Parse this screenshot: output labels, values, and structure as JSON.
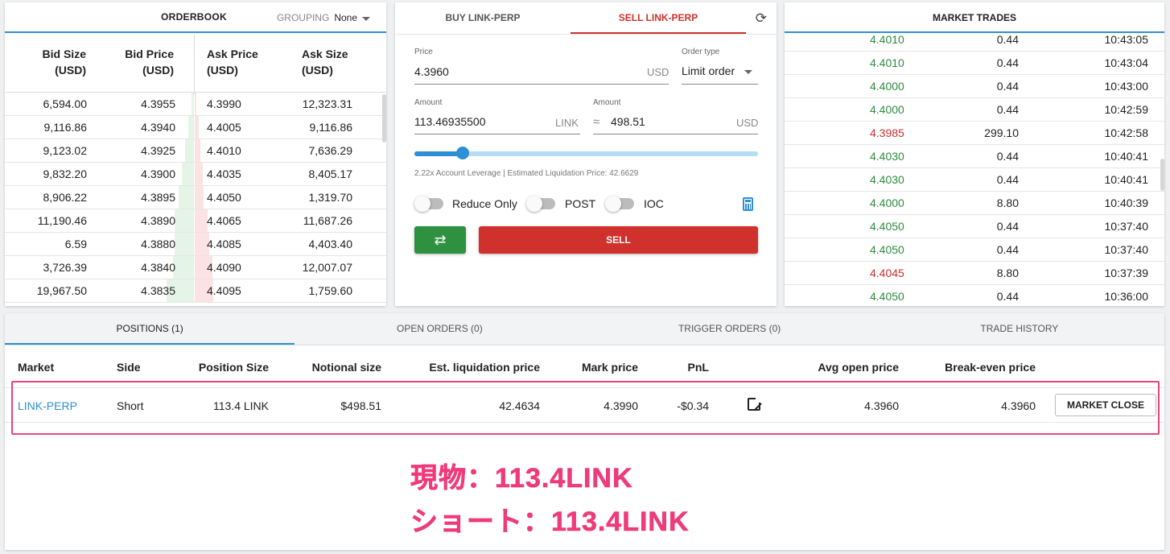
{
  "orderbook": {
    "title": "ORDERBOOK",
    "grouping_label": "GROUPING",
    "grouping_value": "None",
    "columns": [
      "Bid Size",
      "(USD)",
      "Bid Price",
      "(USD)",
      "Ask Price",
      "(USD)",
      "Ask Size",
      "(USD)"
    ],
    "rows": [
      {
        "bid_size": "6,594.00",
        "bid_price": "4.3955",
        "ask_price": "4.3990",
        "ask_size": "12,323.31",
        "bid_depth": 0.04,
        "ask_depth": 0.03
      },
      {
        "bid_size": "9,116.86",
        "bid_price": "4.3940",
        "ask_price": "4.4005",
        "ask_size": "9,116.86",
        "bid_depth": 0.09,
        "ask_depth": 0.06
      },
      {
        "bid_size": "9,123.02",
        "bid_price": "4.3925",
        "ask_price": "4.4010",
        "ask_size": "7,636.29",
        "bid_depth": 0.14,
        "ask_depth": 0.09
      },
      {
        "bid_size": "9,832.20",
        "bid_price": "4.3900",
        "ask_price": "4.4035",
        "ask_size": "8,405.17",
        "bid_depth": 0.19,
        "ask_depth": 0.13
      },
      {
        "bid_size": "8,906.22",
        "bid_price": "4.3895",
        "ask_price": "4.4050",
        "ask_size": "1,319.70",
        "bid_depth": 0.24,
        "ask_depth": 0.14
      },
      {
        "bid_size": "11,190.46",
        "bid_price": "4.3890",
        "ask_price": "4.4065",
        "ask_size": "11,687.26",
        "bid_depth": 0.3,
        "ask_depth": 0.2
      },
      {
        "bid_size": "6.59",
        "bid_price": "4.3880",
        "ask_price": "4.4085",
        "ask_size": "4,403.40",
        "bid_depth": 0.3,
        "ask_depth": 0.22
      },
      {
        "bid_size": "3,726.39",
        "bid_price": "4.3840",
        "ask_price": "4.4090",
        "ask_size": "12,007.07",
        "bid_depth": 0.32,
        "ask_depth": 0.28
      },
      {
        "bid_size": "19,967.50",
        "bid_price": "4.3835",
        "ask_price": "4.4095",
        "ask_size": "1,759.60",
        "bid_depth": 0.42,
        "ask_depth": 0.29
      }
    ]
  },
  "trade_form": {
    "tabs": [
      "BUY LINK-PERP",
      "SELL LINK-PERP"
    ],
    "active_tab": 1,
    "price_label": "Price",
    "price_value": "4.3960",
    "price_unit": "USD",
    "order_type_label": "Order type",
    "order_type_value": "Limit order",
    "amount_label": "Amount",
    "amount_value": "113.46935500",
    "amount_unit": "LINK",
    "amount_usd_label": "Amount",
    "approx_symbol": "≈",
    "amount_usd_value": "498.51",
    "amount_usd_unit": "USD",
    "slider_fraction": 0.14,
    "leverage_text": "2.22x Account Leverage | Estimated Liquidation Price: 42.6629",
    "toggles": [
      {
        "label": "Reduce Only",
        "on": false
      },
      {
        "label": "POST",
        "on": false
      },
      {
        "label": "IOC",
        "on": false
      }
    ],
    "swap_icon": "⇄",
    "sell_label": "SELL",
    "colors": {
      "sell": "#d0312d",
      "swap": "#2e9140",
      "accent": "#2e8fd4"
    }
  },
  "market_trades": {
    "title": "MARKET TRADES",
    "rows": [
      {
        "price": "4.4010",
        "size": "0.44",
        "time": "10:43:05",
        "side": "buy"
      },
      {
        "price": "4.4010",
        "size": "0.44",
        "time": "10:43:04",
        "side": "buy"
      },
      {
        "price": "4.4000",
        "size": "0.44",
        "time": "10:43:00",
        "side": "buy"
      },
      {
        "price": "4.4000",
        "size": "0.44",
        "time": "10:42:59",
        "side": "buy"
      },
      {
        "price": "4.3985",
        "size": "299.10",
        "time": "10:42:58",
        "side": "sell"
      },
      {
        "price": "4.4030",
        "size": "0.44",
        "time": "10:40:41",
        "side": "buy"
      },
      {
        "price": "4.4030",
        "size": "0.44",
        "time": "10:40:41",
        "side": "buy"
      },
      {
        "price": "4.4000",
        "size": "8.80",
        "time": "10:40:39",
        "side": "buy"
      },
      {
        "price": "4.4050",
        "size": "0.44",
        "time": "10:37:40",
        "side": "buy"
      },
      {
        "price": "4.4050",
        "size": "0.44",
        "time": "10:37:40",
        "side": "buy"
      },
      {
        "price": "4.4045",
        "size": "8.80",
        "time": "10:37:39",
        "side": "sell"
      },
      {
        "price": "4.4050",
        "size": "0.44",
        "time": "10:36:00",
        "side": "buy"
      }
    ]
  },
  "positions": {
    "tabs": [
      "POSITIONS (1)",
      "OPEN ORDERS (0)",
      "TRIGGER ORDERS (0)",
      "TRADE HISTORY"
    ],
    "active_tab": 0,
    "headers": {
      "market": "Market",
      "side": "Side",
      "position_size": "Position Size",
      "notional_size": "Notional size",
      "est_liq": "Est. liquidation price",
      "mark_price": "Mark price",
      "pnl": "PnL",
      "avg_open": "Avg open price",
      "break_even": "Break-even price"
    },
    "row": {
      "market": "LINK-PERP",
      "side": "Short",
      "position_size": "113.4 LINK",
      "notional_size": "$498.51",
      "est_liq": "42.4634",
      "mark_price": "4.3990",
      "pnl": "-$0.34",
      "avg_open": "4.3960",
      "break_even": "4.3960",
      "close_label": "MARKET CLOSE"
    }
  },
  "annotation": {
    "line1": "現物：113.4LINK",
    "line2": "ショート：113.4LINK",
    "color": "#ee3b7a"
  }
}
